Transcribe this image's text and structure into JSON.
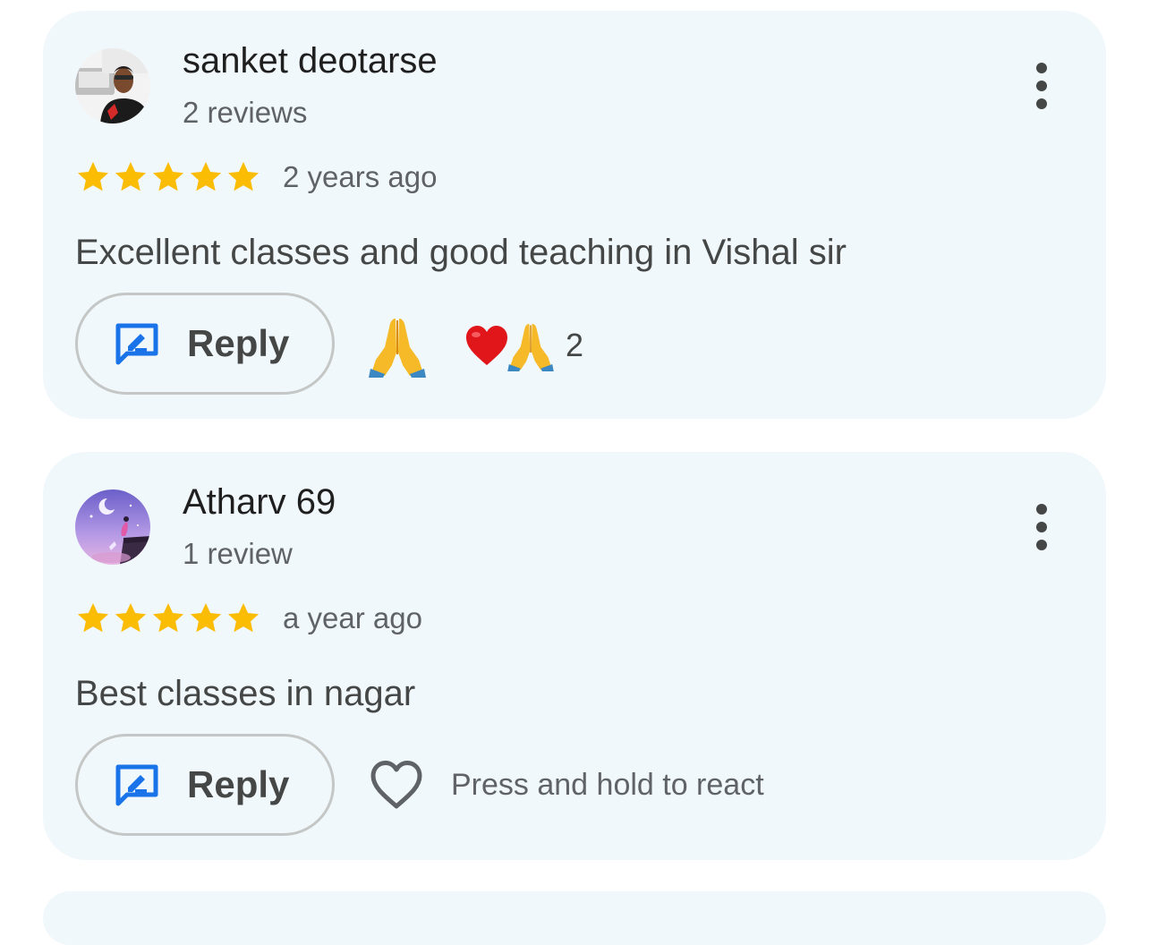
{
  "reviews": [
    {
      "name": "sanket deotarse",
      "review_count": "2 reviews",
      "rating": 5,
      "time_ago": "2 years ago",
      "text": "Excellent classes and good teaching in Vishal sir",
      "reply_label": "Reply",
      "reactions": {
        "quick_react_emoji": "folded-hands",
        "summary_emojis": [
          "red-heart",
          "folded-hands"
        ],
        "count": "2"
      }
    },
    {
      "name": "Atharv 69",
      "review_count": "1 review",
      "rating": 5,
      "time_ago": "a year ago",
      "text": "Best classes in nagar",
      "reply_label": "Reply",
      "react_hint": "Press and hold to react"
    }
  ],
  "colors": {
    "card_background": "#f1f8fc",
    "star": "#fbbc04",
    "reply_icon": "#1a73e8",
    "primary_text": "#1f1f1f",
    "secondary_text": "#5f6368"
  },
  "icons": {
    "more": "more-vert-icon",
    "reply": "reply-icon",
    "star": "star-icon",
    "react": "heart-outline-icon"
  }
}
